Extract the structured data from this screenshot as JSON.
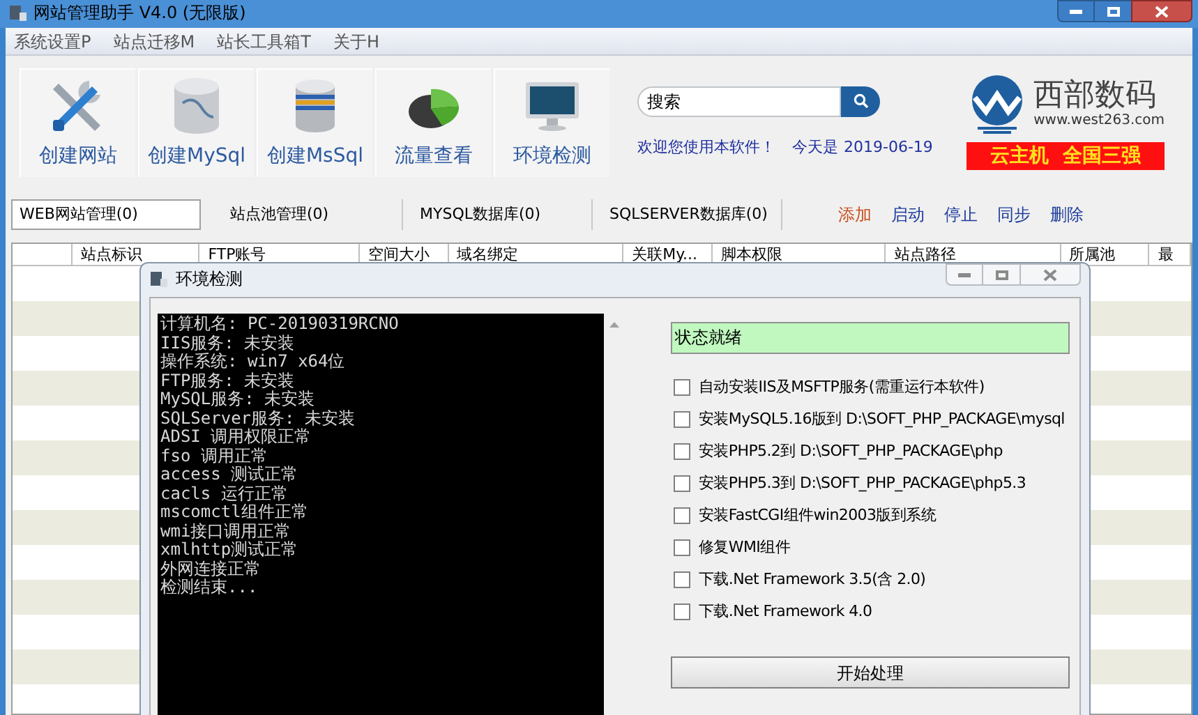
{
  "window": {
    "title": "网站管理助手 V4.0 (无限版)"
  },
  "menu": [
    "系统设置P",
    "站点迁移M",
    "站长工具箱T",
    "关于H"
  ],
  "toolbar": [
    {
      "label": "创建网站",
      "kind": "tools"
    },
    {
      "label": "创建MySql",
      "kind": "mysql"
    },
    {
      "label": "创建MsSql",
      "kind": "mssql"
    },
    {
      "label": "流量查看",
      "kind": "pie"
    },
    {
      "label": "环境检测",
      "kind": "monitor"
    }
  ],
  "search": {
    "placeholder": "搜索"
  },
  "welcome": "欢迎您使用本软件！",
  "today_label": "今天是",
  "date": "2019-06-19",
  "ad": {
    "brand": "西部数码",
    "url": "www.west263.com",
    "slogan": "云主机  全国三强"
  },
  "tabs": [
    {
      "label": "WEB网站管理(0)",
      "selected": true
    },
    {
      "label": "站点池管理(0)",
      "selected": false
    },
    {
      "label": "MYSQL数据库(0)",
      "selected": false
    },
    {
      "label": "SQLSERVER数据库(0)",
      "selected": false
    }
  ],
  "actions": [
    {
      "label": "添加",
      "color": "#c8501e"
    },
    {
      "label": "启动",
      "color": "#1e3c9c"
    },
    {
      "label": "停止",
      "color": "#1e3c9c"
    },
    {
      "label": "同步",
      "color": "#1e3c9c"
    },
    {
      "label": "删除",
      "color": "#1e3c9c"
    }
  ],
  "table": {
    "columns": [
      "站点标识",
      "FTP账号",
      "空间大小",
      "域名绑定",
      "关联My...",
      "脚本权限",
      "站点路径",
      "所属池",
      "最"
    ]
  },
  "dialog": {
    "title": "环境检测",
    "console": [
      "计算机名: PC-20190319RCNO",
      "IIS服务: 未安装",
      "操作系统: win7 x64位",
      "FTP服务: 未安装",
      "MySQL服务: 未安装",
      "SQLServer服务: 未安装",
      "ADSI 调用权限正常",
      "fso 调用正常",
      "access 测试正常",
      "cacls 运行正常",
      "mscomctl组件正常",
      "wmi接口调用正常",
      "xmlhttp测试正常",
      "外网连接正常",
      "检测结束..."
    ],
    "status": "状态就绪",
    "options": [
      {
        "label": "自动安装IIS及MSFTP服务(需重运行本软件)",
        "checked": false
      },
      {
        "label": "安装MySQL5.16版到 D:\\SOFT_PHP_PACKAGE\\mysql",
        "checked": false
      },
      {
        "label": "安装PHP5.2到 D:\\SOFT_PHP_PACKAGE\\php",
        "checked": false
      },
      {
        "label": "安装PHP5.3到 D:\\SOFT_PHP_PACKAGE\\php5.3",
        "checked": false
      },
      {
        "label": "安装FastCGI组件win2003版到系统",
        "checked": false
      },
      {
        "label": "修复WMI组件",
        "checked": false
      },
      {
        "label": "下载.Net Framework 3.5(含 2.0)",
        "checked": false
      },
      {
        "label": "下载.Net Framework 4.0",
        "checked": false
      }
    ],
    "start_button": "开始处理"
  }
}
